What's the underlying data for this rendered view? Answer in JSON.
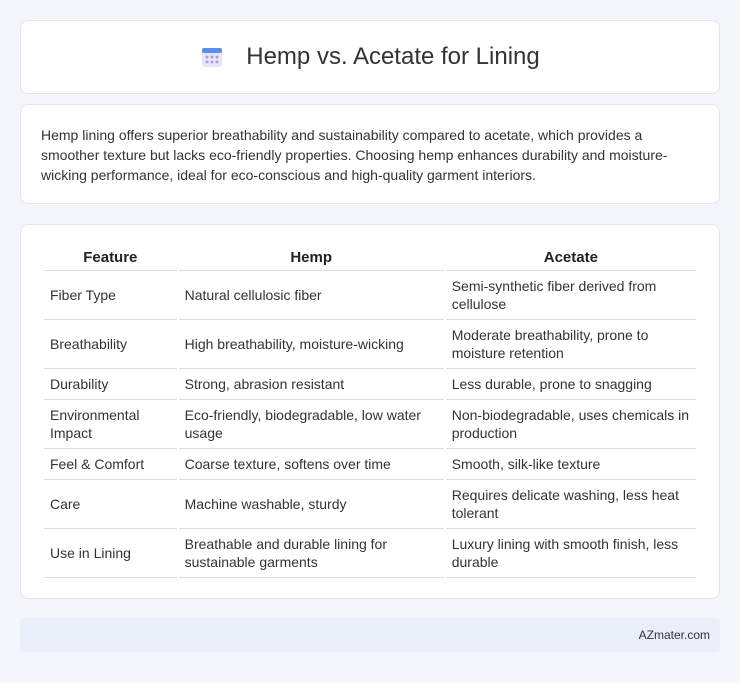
{
  "header": {
    "title": "Hemp vs. Acetate for Lining",
    "icon": "calendar-icon"
  },
  "intro": {
    "text": "Hemp lining offers superior breathability and sustainability compared to acetate, which provides a smoother texture but lacks eco-friendly properties. Choosing hemp enhances durability and moisture-wicking performance, ideal for eco-conscious and high-quality garment interiors."
  },
  "table": {
    "headers": [
      "Feature",
      "Hemp",
      "Acetate"
    ],
    "rows": [
      [
        "Fiber Type",
        "Natural cellulosic fiber",
        "Semi-synthetic fiber derived from cellulose"
      ],
      [
        "Breathability",
        "High breathability, moisture-wicking",
        "Moderate breathability, prone to moisture retention"
      ],
      [
        "Durability",
        "Strong, abrasion resistant",
        "Less durable, prone to snagging"
      ],
      [
        "Environmental Impact",
        "Eco-friendly, biodegradable, low water usage",
        "Non-biodegradable, uses chemicals in production"
      ],
      [
        "Feel & Comfort",
        "Coarse texture, softens over time",
        "Smooth, silk-like texture"
      ],
      [
        "Care",
        "Machine washable, sturdy",
        "Requires delicate washing, less heat tolerant"
      ],
      [
        "Use in Lining",
        "Breathable and durable lining for sustainable garments",
        "Luxury lining with smooth finish, less durable"
      ]
    ]
  },
  "footer": {
    "brand": "AZmater.com"
  }
}
